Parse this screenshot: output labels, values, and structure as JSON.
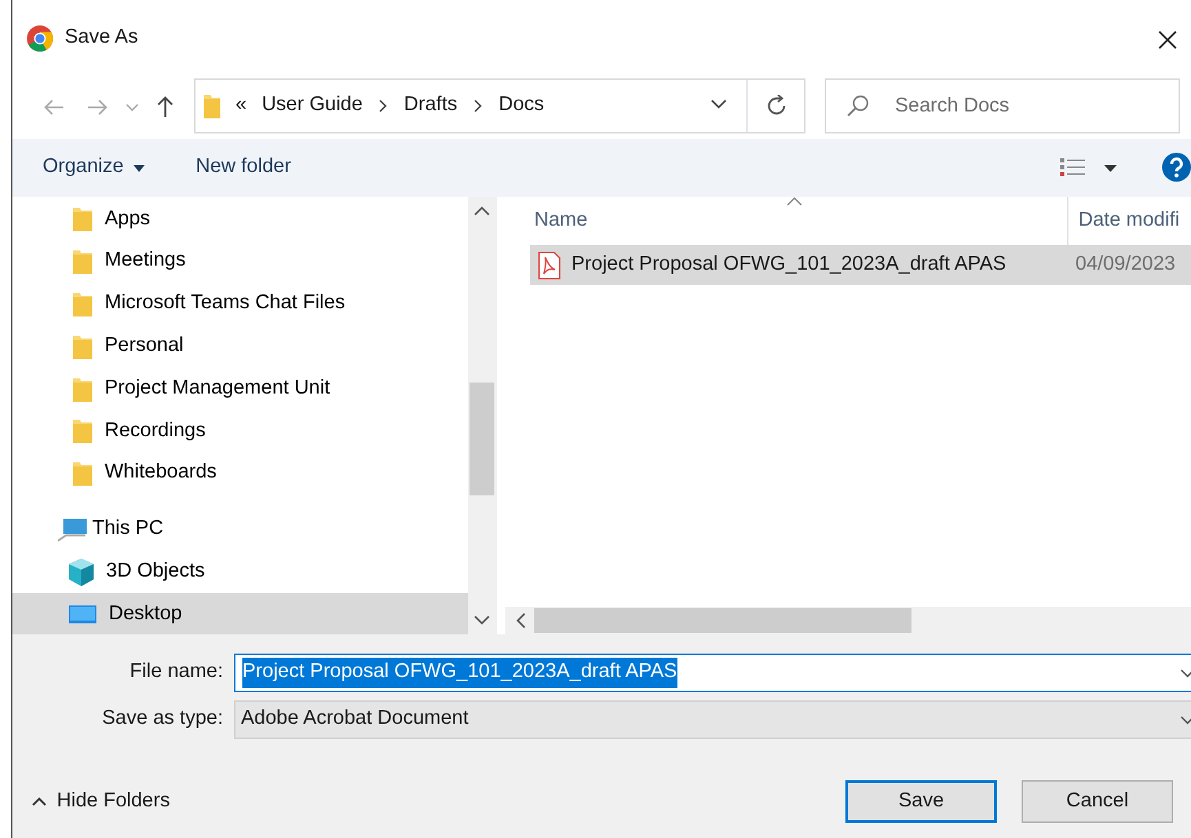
{
  "window": {
    "title": "Save As"
  },
  "address": {
    "overflow": "«",
    "crumbs": [
      "User Guide",
      "Drafts",
      "Docs"
    ]
  },
  "search": {
    "placeholder": "Search Docs"
  },
  "toolbar": {
    "organize": "Organize",
    "new_folder": "New folder"
  },
  "sidebar": {
    "items": [
      {
        "label": "Apps",
        "kind": "folder",
        "selected": false
      },
      {
        "label": "Meetings",
        "kind": "folder",
        "selected": false
      },
      {
        "label": "Microsoft Teams Chat Files",
        "kind": "folder",
        "selected": false
      },
      {
        "label": "Personal",
        "kind": "folder",
        "selected": false
      },
      {
        "label": "Project Management Unit",
        "kind": "folder",
        "selected": false
      },
      {
        "label": "Recordings",
        "kind": "folder",
        "selected": false
      },
      {
        "label": "Whiteboards",
        "kind": "folder",
        "selected": false
      },
      {
        "label": "This PC",
        "kind": "pc",
        "selected": false,
        "children": [
          {
            "label": "3D Objects",
            "kind": "objects3d",
            "selected": false
          },
          {
            "label": "Desktop",
            "kind": "desktop",
            "selected": true
          }
        ]
      }
    ]
  },
  "files": {
    "columns": [
      "Name",
      "Date modifi"
    ],
    "rows": [
      {
        "name": "Project Proposal OFWG_101_2023A_draft APAS",
        "date": "04/09/2023",
        "selected": true
      }
    ]
  },
  "form": {
    "file_name_label": "File name:",
    "file_name": "Project Proposal OFWG_101_2023A_draft APAS",
    "file_name_selected": true,
    "type_label": "Save as type:",
    "type": "Adobe Acrobat Document"
  },
  "footer": {
    "hide_folders": "Hide Folders",
    "buttons": [
      {
        "label": "Save",
        "kind": "default"
      },
      {
        "label": "Cancel",
        "kind": "normal"
      }
    ]
  }
}
